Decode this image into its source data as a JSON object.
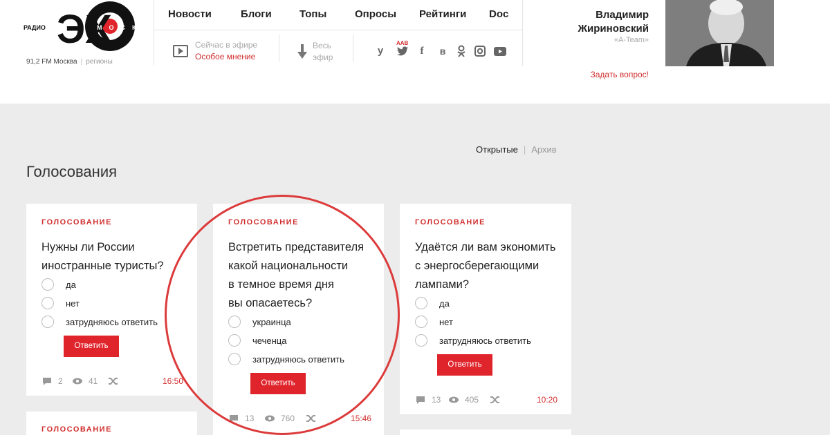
{
  "header": {
    "logo_radio": "РАДИО",
    "logo_main": "ЭХО",
    "logo_moskvy": "МОСКВЫ",
    "frequency": "91,2 FM Москва",
    "regions": "регионы",
    "nav": [
      "Новости",
      "Блоги",
      "Топы",
      "Опросы",
      "Рейтинги",
      "Doc"
    ],
    "on_air_label": "Сейчас в эфире",
    "on_air_show": "Особое мнение",
    "archive_label": "Весь эфир",
    "aab": "AAB",
    "social_icons": [
      "yandex-icon",
      "twitter-icon",
      "facebook-icon",
      "vk-icon",
      "odnoklassniki-icon",
      "instagram-icon",
      "youtube-icon"
    ],
    "host_name_line1": "Владимир",
    "host_name_line2": "Жириновский",
    "host_show": "«A-Team»",
    "ask_question": "Задать вопрос!"
  },
  "main": {
    "filter_open": "Открытые",
    "filter_archive": "Архив",
    "title": "Голосования"
  },
  "cards": [
    {
      "tag": "Голосование",
      "question_lines": [
        "Нужны ли России",
        "иностранные туристы?"
      ],
      "options": [
        "да",
        "нет",
        "затрудняюсь ответить"
      ],
      "button": "Ответить",
      "comments": "2",
      "views": "41",
      "time": "16:50"
    },
    {
      "tag": "Голосование",
      "question_lines": [
        "Встретить представителя",
        "какой национальности",
        "в темное время дня",
        "вы опасаетесь?"
      ],
      "options": [
        "украинца",
        "чеченца",
        "затрудняюсь ответить"
      ],
      "button": "Ответить",
      "comments": "13",
      "views": "760",
      "time": "15:46"
    },
    {
      "tag": "Голосование",
      "question_lines": [
        "Удаётся ли вам экономить",
        "с энергосберегающими",
        "лампами?"
      ],
      "options": [
        "да",
        "нет",
        "затрудняюсь ответить"
      ],
      "button": "Ответить",
      "comments": "13",
      "views": "405",
      "time": "10:20"
    },
    {
      "tag": "Голосование"
    }
  ],
  "colors": {
    "accent": "#e0242c",
    "highlight_circle": "#dc3b3b",
    "background": "#ececec"
  }
}
